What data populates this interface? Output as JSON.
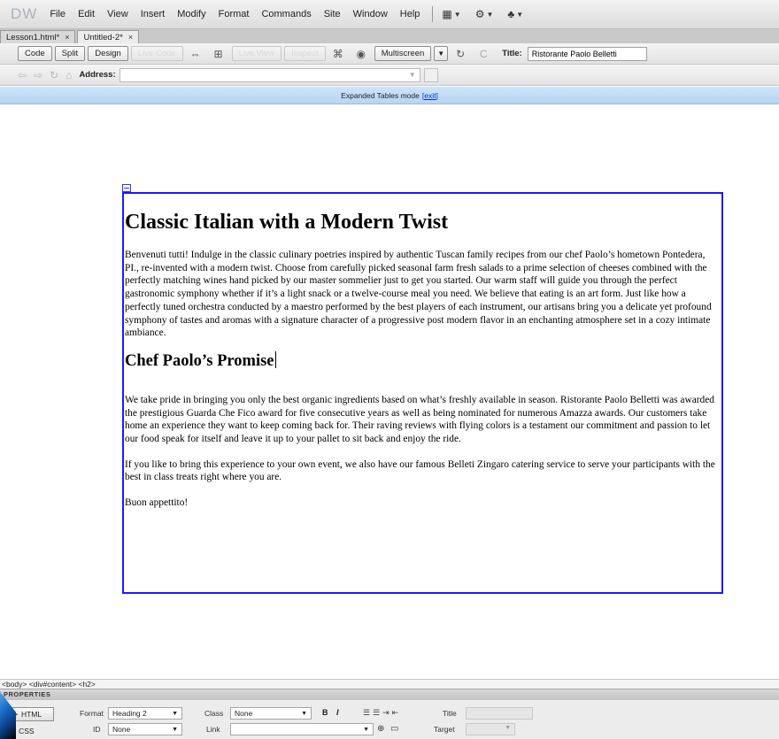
{
  "app": {
    "logo": "DW",
    "menus": [
      "File",
      "Edit",
      "View",
      "Insert",
      "Modify",
      "Format",
      "Commands",
      "Site",
      "Window",
      "Help"
    ]
  },
  "tabs": [
    {
      "label": "Lesson1.html*",
      "close": "×",
      "active": false
    },
    {
      "label": "Untitled-2*",
      "close": "×",
      "active": true
    }
  ],
  "toolbar": {
    "code": "Code",
    "split": "Split",
    "design": "Design",
    "live_code": "Live Code",
    "live_view": "Live View",
    "inspect": "Inspect",
    "multiscreen": "Multiscreen",
    "title_label": "Title:",
    "title_value": "Ristorante Paolo Belletti"
  },
  "address": {
    "label": "Address:",
    "value": ""
  },
  "expanded_tables": {
    "message": "Expanded Tables mode",
    "exit_link": "[exit]"
  },
  "content": {
    "heading": "Classic Italian with a Modern Twist",
    "intro": "Benvenuti tutti! Indulge in the classic culinary poetries inspired by authentic Tuscan family recipes from our chef Paolo’s hometown Pontedera, PI., re-invented with a modern twist.  Choose from carefully picked seasonal farm fresh salads to a prime selection of cheeses combined with the perfectly matching wines hand picked by our master sommelier just to get you started.  Our warm staff will guide you through the perfect gastronomic symphony whether if it’s a light snack or a twelve-course meal you need.  We believe that eating is an art form.  Just like how a perfectly tuned orchestra conducted by a maestro performed by the best players of each instrument, our artisans bring you a delicate yet profound symphony of tastes and aromas with a signature character of a progressive post modern flavor in an enchanting atmosphere set in a cozy intimate ambiance.",
    "subheading": "Chef Paolo’s Promise",
    "promise": "We take pride in bringing you only the best organic ingredients based on what’s freshly available in season.  Ristorante Paolo Belletti was awarded the prestigious Guarda Che Fico award for five consecutive years as well as being nominated for numerous Amazza awards.  Our customers take home an experience they want to keep coming back for.  Their raving reviews with flying colors is a testament our commitment and passion to let our food speak for itself and leave it up to your pallet to sit back and enjoy the ride.",
    "catering": "If you like to bring this experience to your own event, we also have our famous Belleti Zingaro catering service to serve your participants with the best in class treats right where you are.",
    "closing": "Buon appettito!"
  },
  "status": {
    "tag_selector": "<body> <div#content> <h2>"
  },
  "properties": {
    "header": "PROPERTIES",
    "html_btn": "HTML",
    "css_btn": "CSS",
    "format_label": "Format",
    "format_value": "Heading 2",
    "id_label": "ID",
    "id_value": "None",
    "class_label": "Class",
    "class_value": "None",
    "link_label": "Link",
    "bold": "B",
    "italic": "I",
    "title_label": "Title",
    "target_label": "Target"
  },
  "colors": {
    "div_outline": "#1a1aff",
    "expanded_bar": "#bcd6f2",
    "exit_link": "#0033cc"
  }
}
